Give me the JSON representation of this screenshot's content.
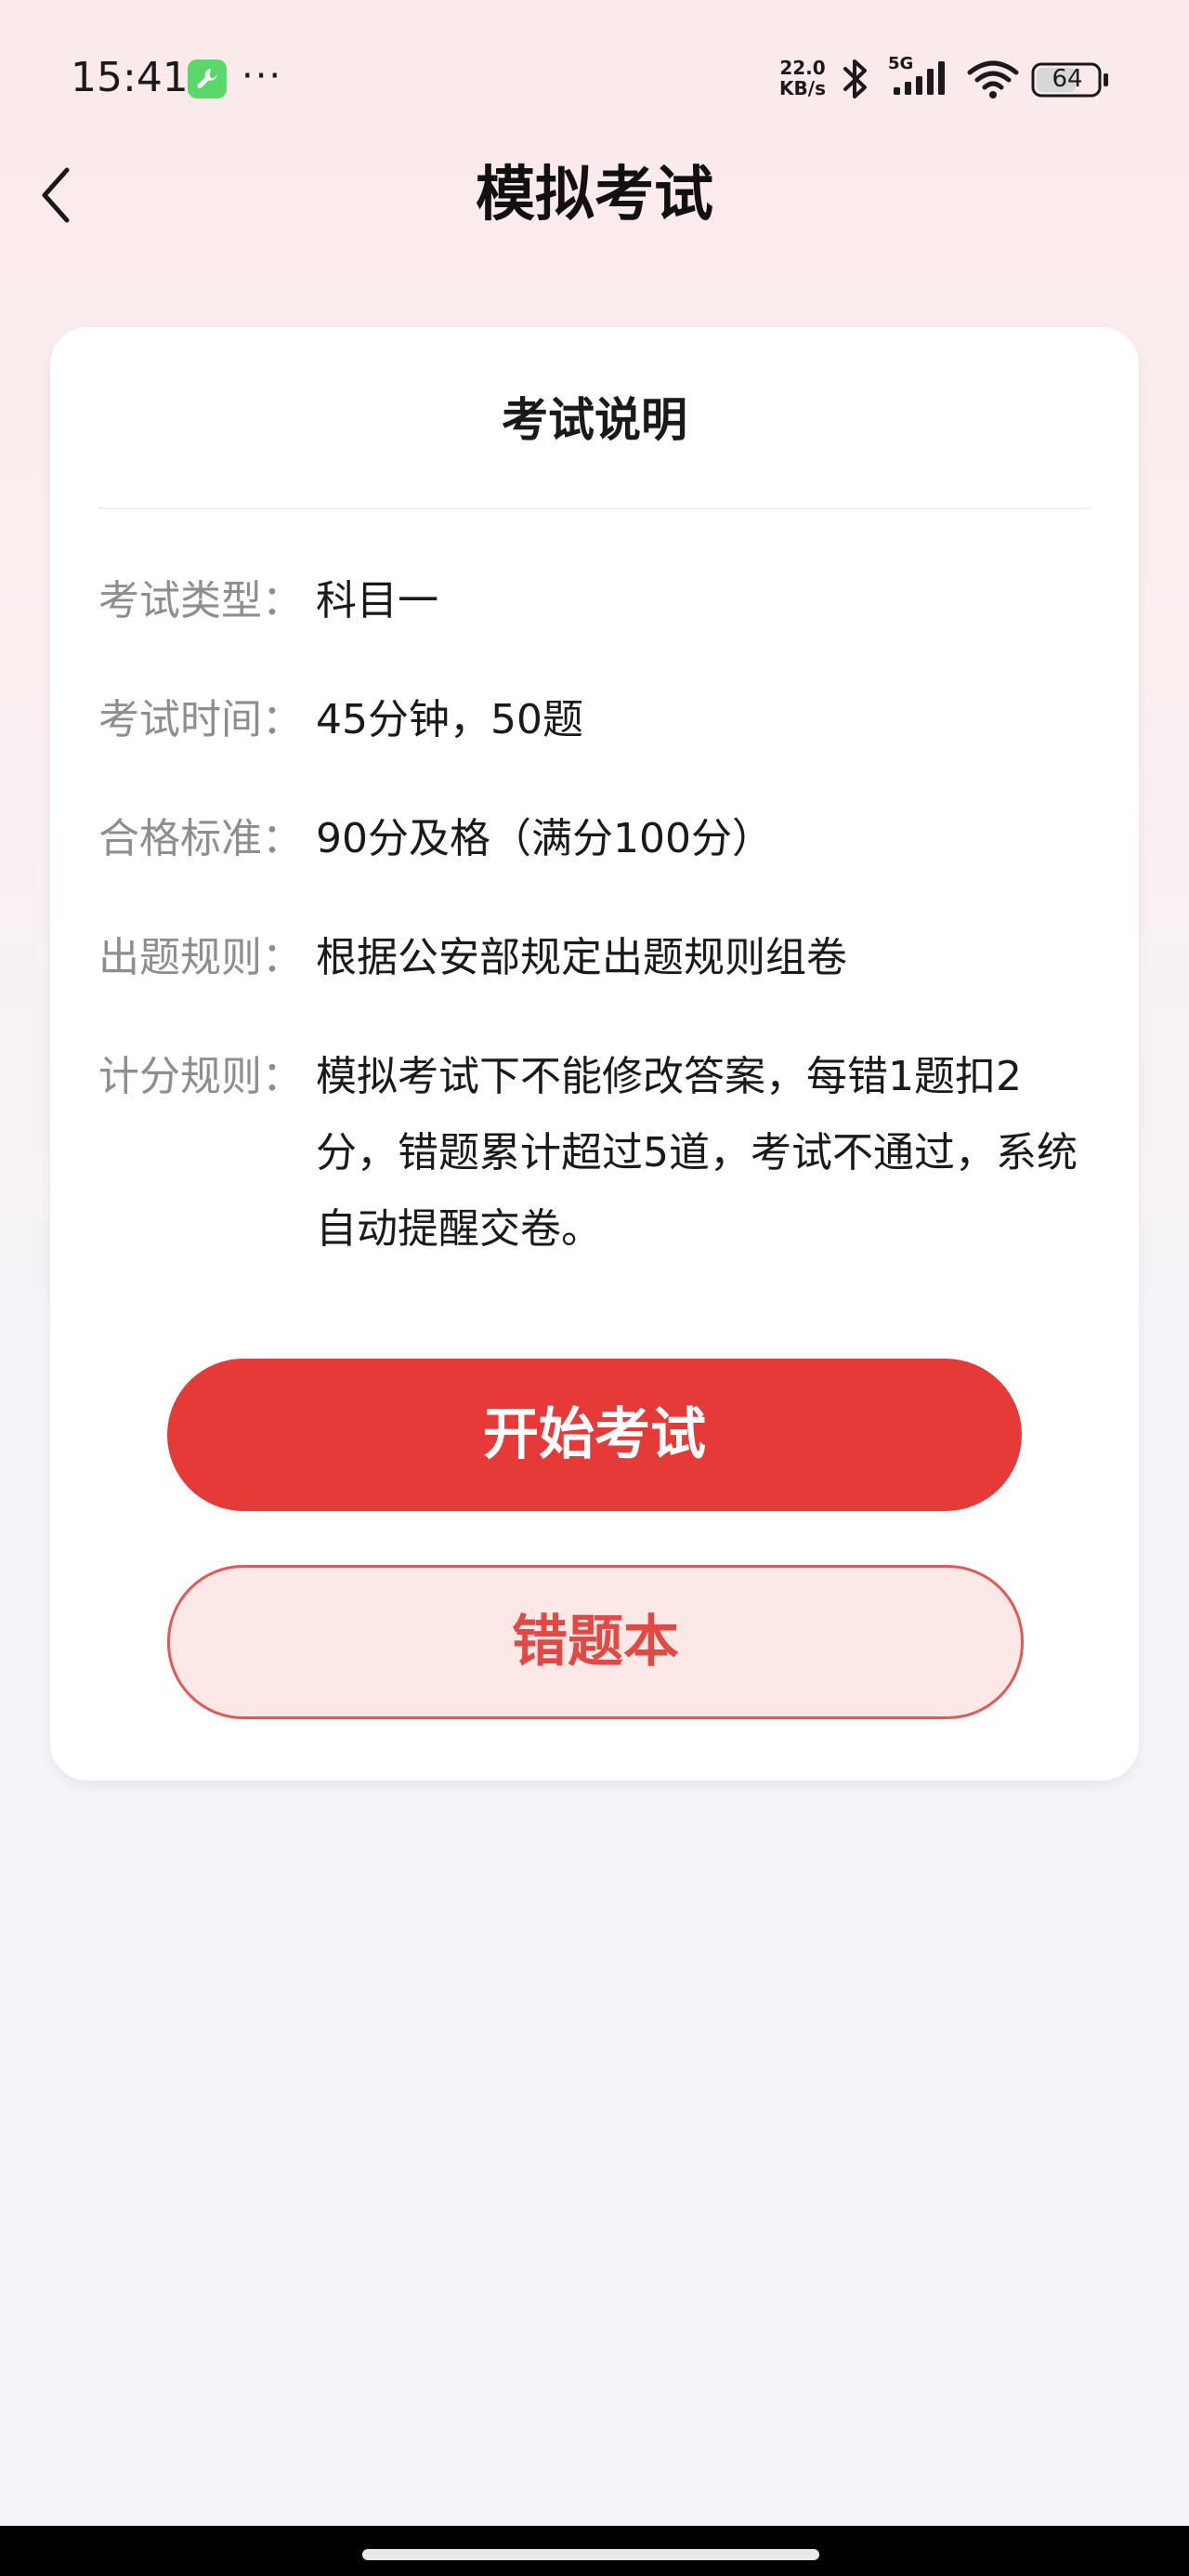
{
  "status_bar": {
    "time": "15:41",
    "more": "···",
    "net_speed_value": "22.0",
    "net_speed_unit": "KB/s",
    "signal_label": "5G",
    "battery": "64",
    "icons": [
      "tools-app-icon",
      "bluetooth-icon",
      "signal-icon",
      "wifi-icon",
      "battery-icon"
    ]
  },
  "header": {
    "title": "模拟考试",
    "back_icon": "chevron-left-icon"
  },
  "card": {
    "title": "考试说明",
    "rows": [
      {
        "label": "考试类型：",
        "value": "科目一"
      },
      {
        "label": "考试时间：",
        "value": "45分钟，50题"
      },
      {
        "label": "合格标准：",
        "value": "90分及格（满分100分）"
      },
      {
        "label": "出题规则：",
        "value": "根据公安部规定出题规则组卷"
      },
      {
        "label": "计分规则：",
        "value": "模拟考试下不能修改答案，每错1题扣2分，错题累计超过5道，考试不通过，系统自动提醒交卷。"
      }
    ]
  },
  "buttons": {
    "start": "开始考试",
    "wrong_book": "错题本"
  },
  "colors": {
    "accent": "#e53a37",
    "secondary_bg": "#fde8e8",
    "secondary_border": "#e45854",
    "label_gray": "#8e8e8e"
  }
}
